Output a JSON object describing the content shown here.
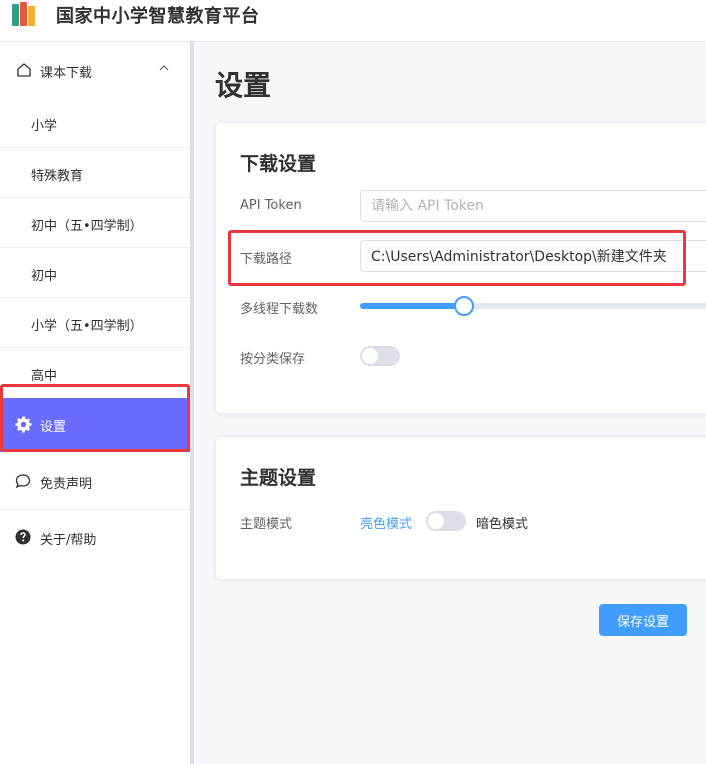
{
  "app": {
    "title": "国家中小学智慧教育平台",
    "logo_icon": "books-logo-icon"
  },
  "sidebar": {
    "group": {
      "label": "课本下载",
      "icon": "home-icon",
      "expanded_icon": "chevron-up-icon"
    },
    "sub_items": [
      {
        "label": "小学"
      },
      {
        "label": "特殊教育"
      },
      {
        "label": "初中（五•四学制）"
      },
      {
        "label": "初中"
      },
      {
        "label": "小学（五•四学制）"
      },
      {
        "label": "高中"
      }
    ],
    "settings": {
      "label": "设置",
      "icon": "gear-icon",
      "active": true,
      "active_color": "#6a6cff"
    },
    "disclaimer": {
      "label": "免责声明",
      "icon": "chat-bubble-icon"
    },
    "about": {
      "label": "关于/帮助",
      "icon": "question-circle-icon"
    }
  },
  "main": {
    "page_title": "设置",
    "download_settings": {
      "title": "下载设置",
      "api_token": {
        "label": "API Token",
        "value": "",
        "placeholder": "请输入 API Token"
      },
      "download_path": {
        "label": "下载路径",
        "value": "C:\\Users\\Administrator\\Desktop\\新建文件夹"
      },
      "threads": {
        "label": "多线程下载数",
        "level_fraction": 0.29
      },
      "categorize": {
        "label": "按分类保存",
        "on": false
      }
    },
    "theme_settings": {
      "title": "主题设置",
      "mode_label": "主题模式",
      "light_label": "亮色模式",
      "dark_label": "暗色模式",
      "dark_on": false
    },
    "save_button": "保存设置"
  },
  "colors": {
    "accent": "#409eff",
    "highlight_red": "#e8383d",
    "sidebar_active": "#6a6cff"
  }
}
